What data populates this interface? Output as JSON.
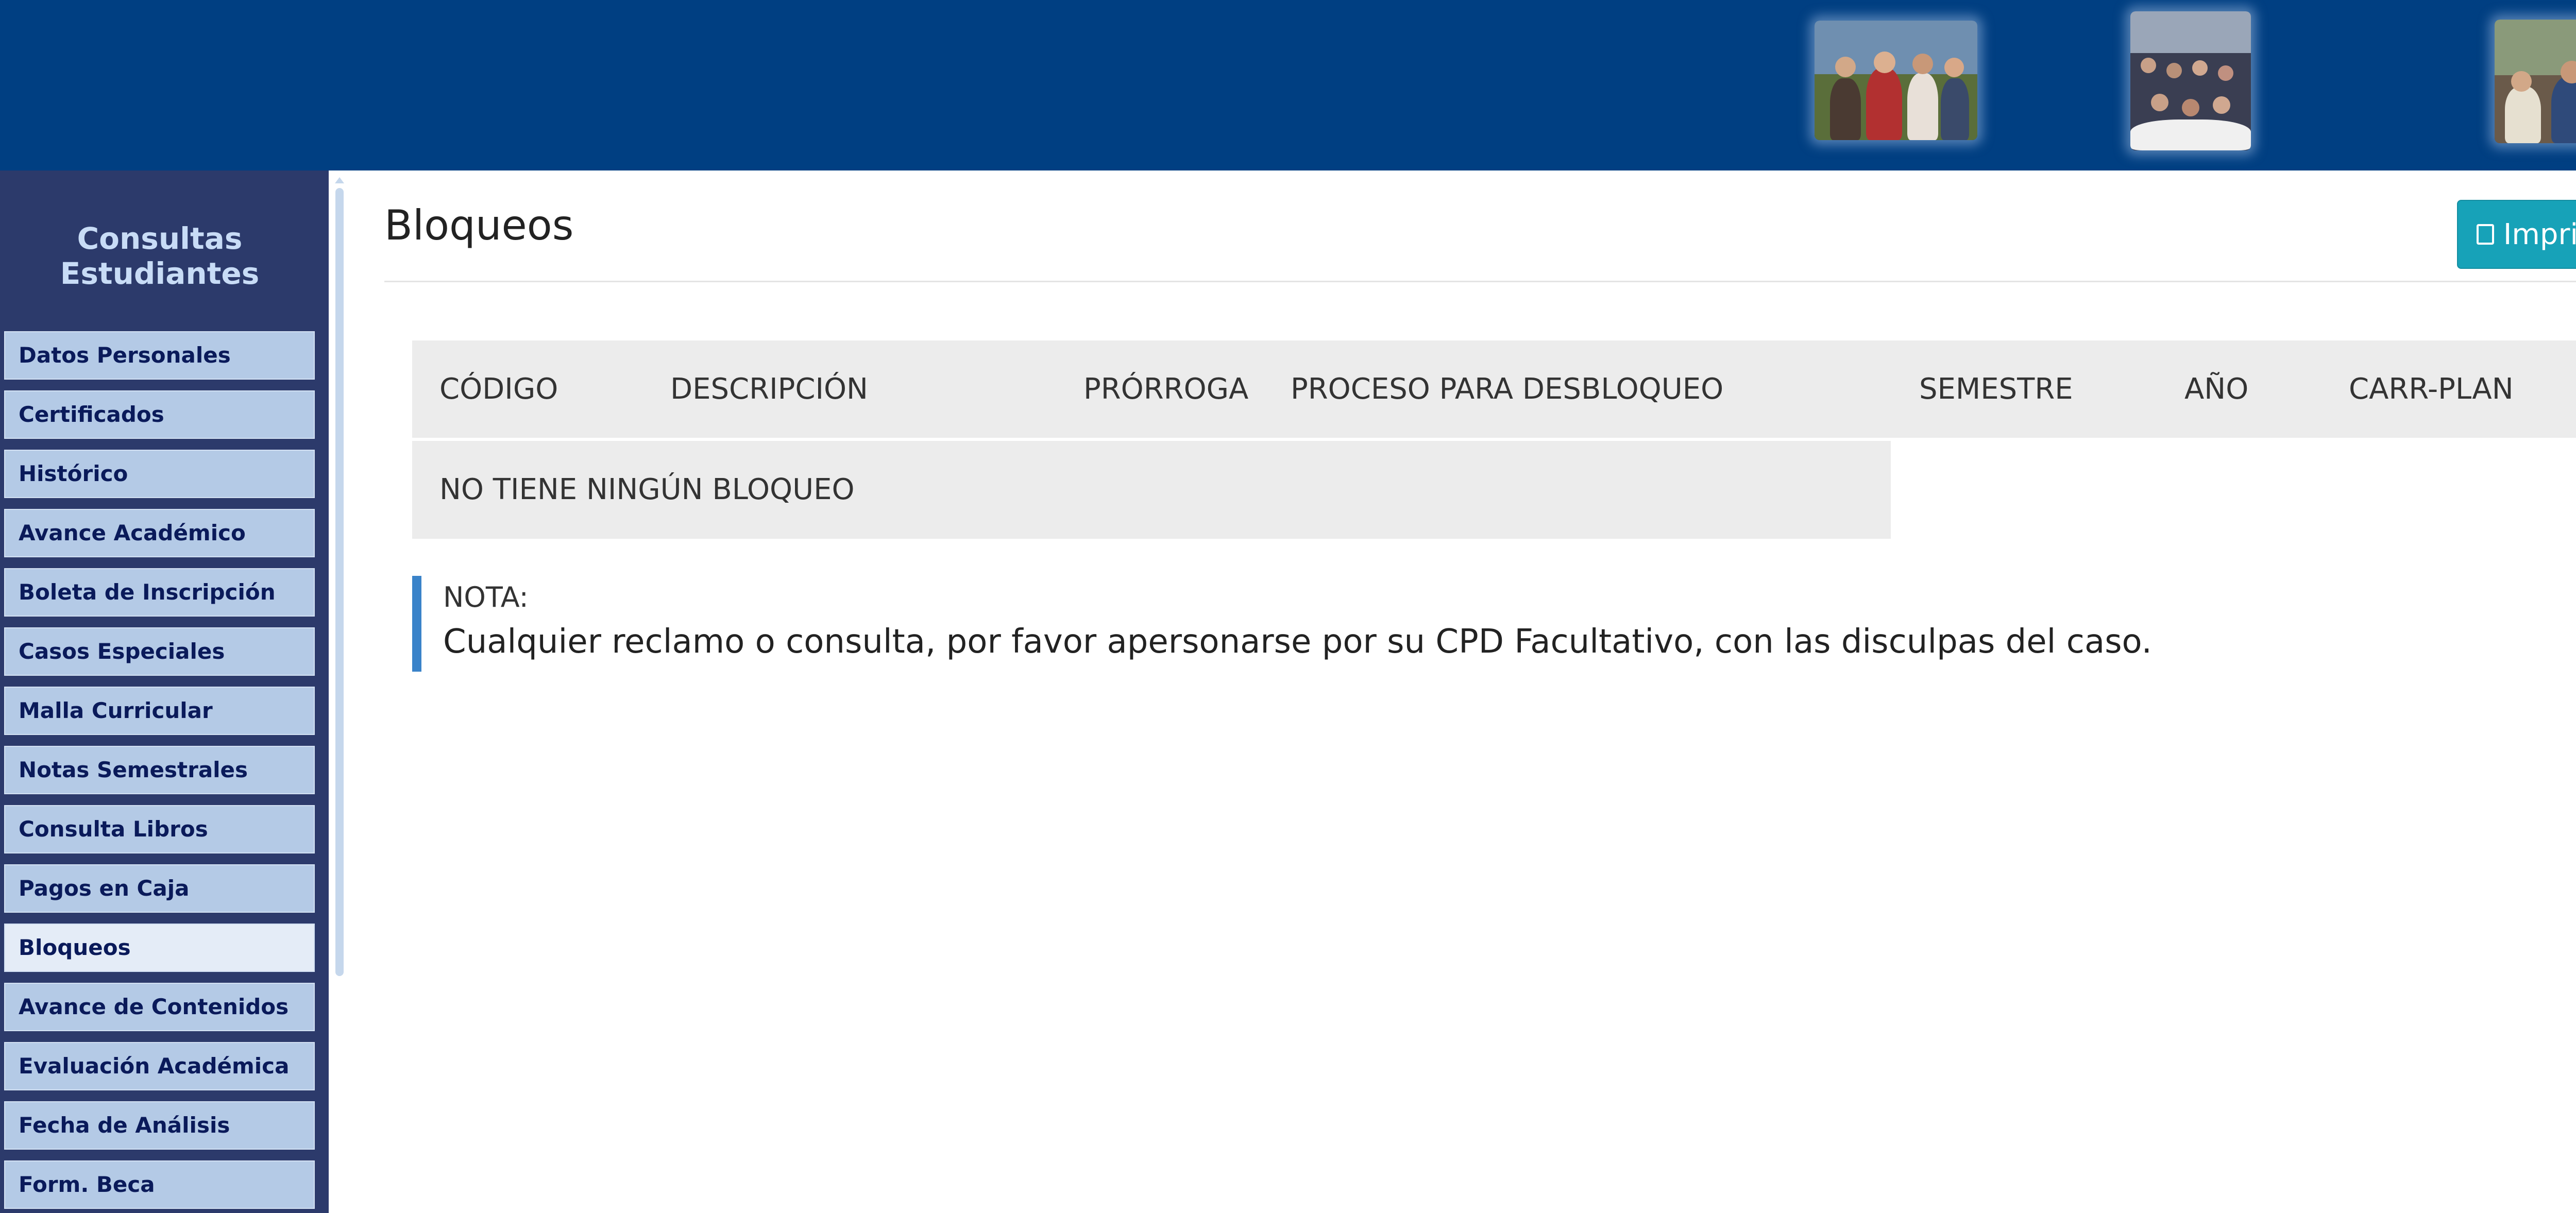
{
  "sidebar": {
    "title_line1": "Consultas",
    "title_line2": "Estudiantes",
    "items": [
      {
        "label": "Datos Personales"
      },
      {
        "label": "Certificados"
      },
      {
        "label": "Histórico"
      },
      {
        "label": "Avance Académico"
      },
      {
        "label": "Boleta de Inscripción"
      },
      {
        "label": "Casos Especiales"
      },
      {
        "label": "Malla Curricular"
      },
      {
        "label": "Notas Semestrales"
      },
      {
        "label": "Consulta Libros"
      },
      {
        "label": "Pagos en Caja"
      },
      {
        "label": "Bloqueos"
      },
      {
        "label": "Avance de Contenidos"
      },
      {
        "label": "Evaluación Académica"
      },
      {
        "label": "Fecha de Análisis"
      },
      {
        "label": "Form. Beca"
      }
    ],
    "active_item": "Bloqueos"
  },
  "main": {
    "title": "Bloqueos",
    "print_label": "Imprimir",
    "print_icon": "print-icon",
    "table": {
      "columns": [
        "CÓDIGO",
        "DESCRIPCIÓN",
        "PRÓRROGA",
        "PROCESO PARA DESBLOQUEO",
        "SEMESTRE",
        "AÑO",
        "CARR-PLAN"
      ],
      "empty_message": "NO TIENE NINGÚN BLOQUEO"
    },
    "note": {
      "label": "NOTA:",
      "text": "Cualquier reclamo o consulta, por favor apersonarse por su CPD Facultativo, con las disculpas del caso."
    }
  },
  "colors": {
    "header_bg": "#003f82",
    "sidebar_bg": "#2c3a6b",
    "menu_item_bg": "#b4cae6",
    "menu_item_active_bg": "#e4ecf7",
    "button_bg": "#17a2b8",
    "note_border": "#3a83c9",
    "table_bg": "#ececec"
  }
}
